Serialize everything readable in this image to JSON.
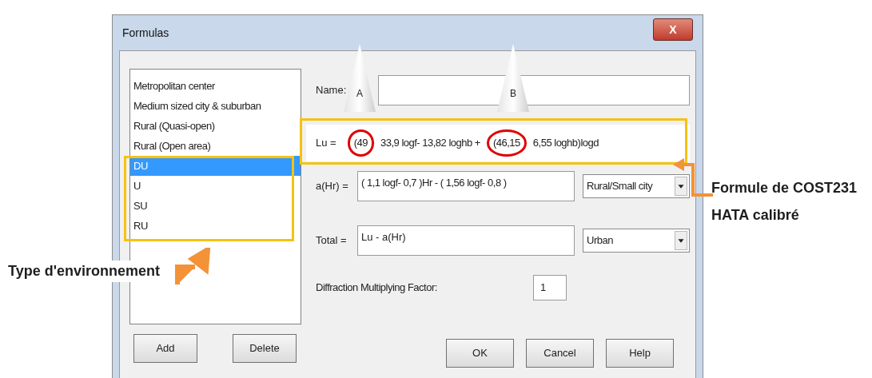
{
  "window": {
    "title": "Formulas",
    "close_label": "X"
  },
  "environments": [
    {
      "label": "Metropolitan center",
      "selected": false
    },
    {
      "label": "Medium sized city & suburban",
      "selected": false
    },
    {
      "label": "Rural (Quasi-open)",
      "selected": false
    },
    {
      "label": "Rural (Open area)",
      "selected": false
    },
    {
      "label": "DU",
      "selected": true
    },
    {
      "label": "U",
      "selected": false
    },
    {
      "label": "SU",
      "selected": false
    },
    {
      "label": "RU",
      "selected": false
    }
  ],
  "left_buttons": [
    "Add",
    "Delete"
  ],
  "name": {
    "label": "Name:"
  },
  "lu": {
    "label": "Lu =",
    "parts": [
      {
        "text": "(49",
        "circled": true
      },
      {
        "text": "33,9 logf- 13,82 loghb +",
        "circled": false
      },
      {
        "text": "(46,15",
        "circled": true
      },
      {
        "text": "6,55 loghb)logd",
        "circled": false
      }
    ]
  },
  "ahr": {
    "label": "a(Hr) =",
    "value": "( 1,1 logf- 0,7 )Hr - ( 1,56 logf- 0,8 )",
    "dropdown": "Rural/Small city"
  },
  "total": {
    "label": "Total =",
    "value": "Lu - a(Hr)",
    "dropdown": "Urban"
  },
  "diffraction": {
    "label": "Diffraction Multiplying Factor:",
    "value": "1"
  },
  "buttons": [
    "OK",
    "Cancel",
    "Help"
  ],
  "annotations": {
    "markers": [
      "A",
      "B"
    ],
    "environment_note": "Type d'environnement",
    "formula_note": [
      "Formule de COST231",
      "HATA calibré"
    ]
  }
}
